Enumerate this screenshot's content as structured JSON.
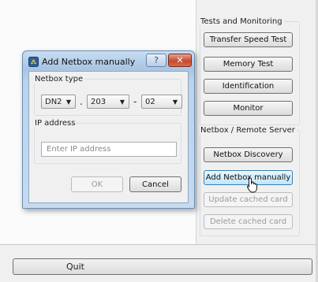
{
  "main": {
    "quit_label": "Quit"
  },
  "tests": {
    "legend": "Tests and Monitoring",
    "buttons": [
      "Transfer Speed Test",
      "Memory Test",
      "Identification",
      "Monitor"
    ]
  },
  "netbox": {
    "legend": "Netbox / Remote Server",
    "discovery": "Netbox Discovery",
    "add_manual": "Add Netbox manually",
    "update_cached": "Update cached card",
    "delete_cached": "Delete cached card"
  },
  "dialog": {
    "title": "Add Netbox manually",
    "help_glyph": "?",
    "close_glyph": "✕",
    "netbox_type": {
      "legend": "Netbox type",
      "model": "DN2",
      "dot": ".",
      "number": "203",
      "dash": "-",
      "variant": "02"
    },
    "ip": {
      "legend": "IP address",
      "placeholder": "Enter IP address"
    },
    "ok_label": "OK",
    "cancel_label": "Cancel"
  },
  "icons": {
    "app": "netbox-app-icon",
    "dropdown": "chevron-down-icon",
    "pointer": "hand-pointer-icon"
  },
  "colors": {
    "title_bar": "#b0c9e6",
    "close_button": "#c44a2f",
    "hover_button": "#bee6fd"
  }
}
